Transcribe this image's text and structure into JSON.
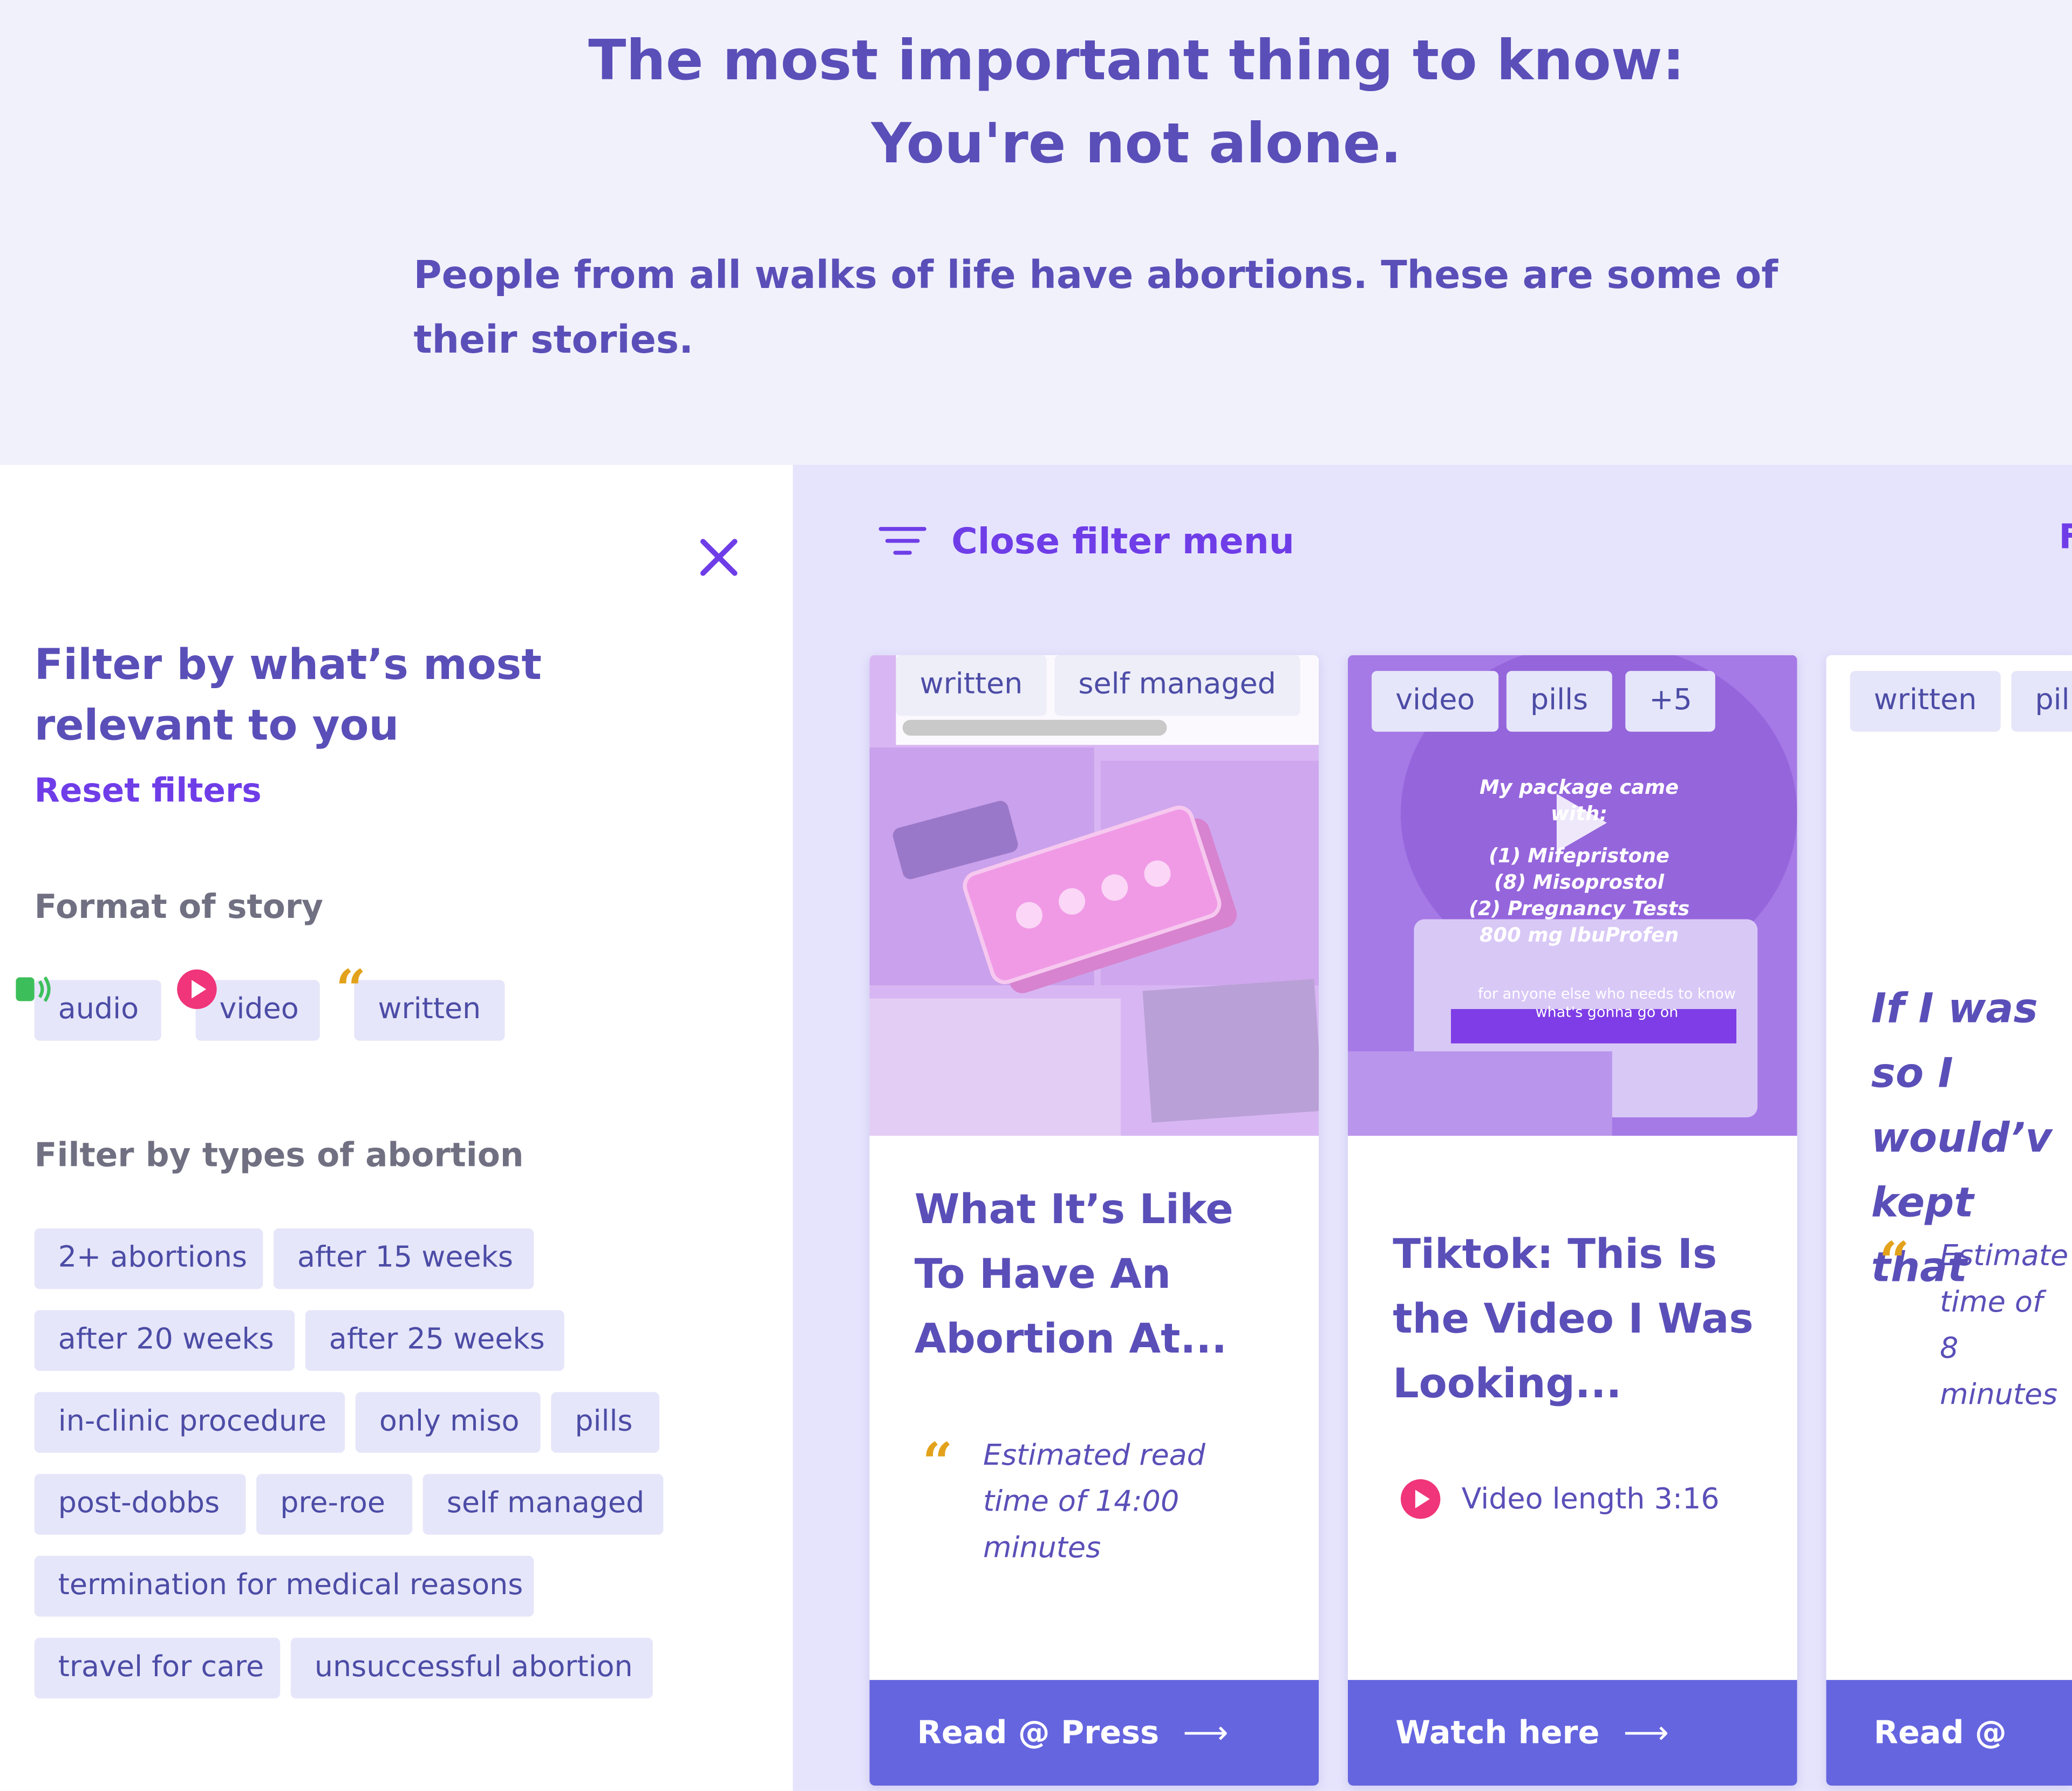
{
  "hero": {
    "title_line1": "The most important thing to know:",
    "title_line2": "You're not alone.",
    "subtitle": "People from all walks of life have abortions. These are some of their stories."
  },
  "sidebar": {
    "close_icon": "close-icon",
    "heading": "Filter by what’s most relevant to you",
    "reset_label": "Reset filters",
    "format_label": "Format of story",
    "formats": [
      {
        "label": "audio",
        "icon": "speaker-icon"
      },
      {
        "label": "video",
        "icon": "play-icon"
      },
      {
        "label": "written",
        "icon": "quote-icon"
      }
    ],
    "types_label": "Filter by types of abortion",
    "types": [
      "2+ abortions",
      "after 15 weeks",
      "after 20 weeks",
      "after 25 weeks",
      "in-clinic procedure",
      "only miso",
      "pills",
      "post-dobbs",
      "pre-roe",
      "self managed",
      "termination for medical reasons",
      "travel for care",
      "unsuccessful abortion"
    ]
  },
  "content": {
    "filter_toggle_label": "Close filter menu",
    "cards": [
      {
        "tags": [
          "written",
          "self managed"
        ],
        "title": "What It’s Like To Have An Abortion At...",
        "meta": "Estimated read time of 14:00 minutes",
        "cta": "Read @ Press"
      },
      {
        "tags": [
          "video",
          "pills",
          "+5"
        ],
        "title": "Tiktok: This Is the Video I Was Looking...",
        "meta": "Video length 3:16",
        "cta": "Watch here",
        "video_overlay": [
          "My package came with:",
          "(1) Mifepristone",
          "(8) Misoprostol",
          "(2) Pregnancy Tests",
          "800 mg IbuProfen",
          "for anyone else who needs to know what's gonna go on"
        ]
      },
      {
        "tags": [
          "written",
          "pil"
        ],
        "quote": "If I was so I would’v kept that",
        "meta": "Estimate time of 8 minutes",
        "cta": "Read @ Pres"
      }
    ]
  },
  "colors": {
    "accent": "#6f3de8",
    "primary_text": "#5a4fb8",
    "chip_bg": "#e6e6fa",
    "cta_bg": "#6565e0",
    "quote": "#e3a21b",
    "play": "#f0357a",
    "audio": "#3cbf5a"
  }
}
